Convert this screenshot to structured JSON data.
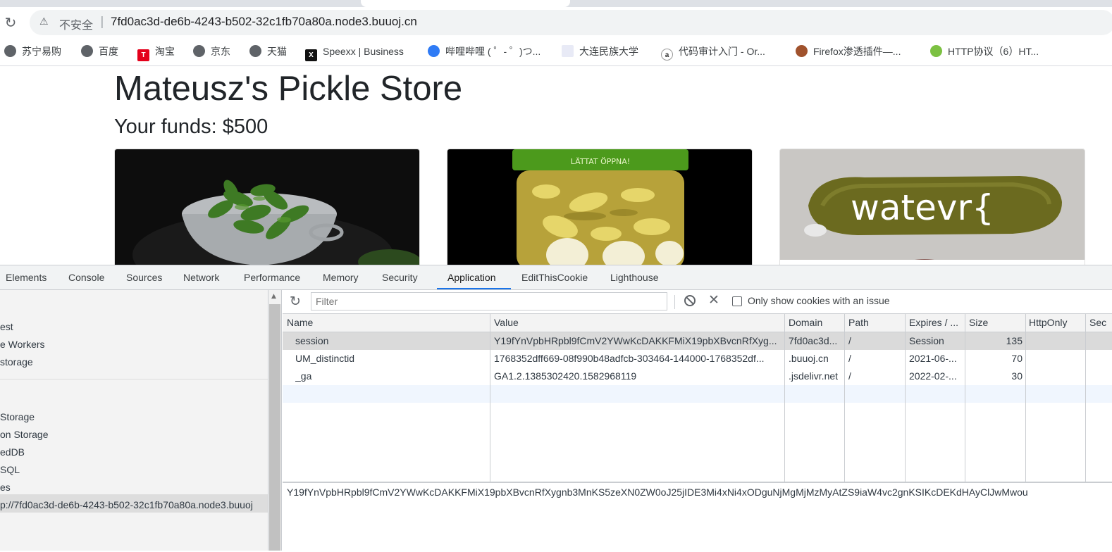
{
  "browser": {
    "omnibox": {
      "security_label": "不安全",
      "separator": "|",
      "url": "7fd0ac3d-de6b-4243-b502-32c1fb70a80a.node3.buuoj.cn"
    },
    "bookmarks": [
      {
        "label": "苏宁易购",
        "icon": "globe-icon"
      },
      {
        "label": "百度",
        "icon": "globe-icon"
      },
      {
        "label": "淘宝",
        "icon": "taobao-icon"
      },
      {
        "label": "京东",
        "icon": "globe-icon"
      },
      {
        "label": "天猫",
        "icon": "globe-icon"
      },
      {
        "label": "Speexx | Business",
        "icon": "speexx-icon"
      },
      {
        "label": "哔哩哔哩 ( ゜- ゜)つ...",
        "icon": "bilibili-icon"
      },
      {
        "label": "大连民族大学",
        "icon": "page-icon"
      },
      {
        "label": "代码审计入门 - Or...",
        "icon": "site-icon"
      },
      {
        "label": "Firefox渗透插件—...",
        "icon": "firefox-plugin-icon"
      },
      {
        "label": "HTTP协议（6）HT...",
        "icon": "leaf-icon"
      }
    ]
  },
  "page": {
    "title": "Mateusz's Pickle Store",
    "funds": "Your funds: $500",
    "card3_overlay_text": "watevr{",
    "jar_lid_text": "LÄTTAT ÖPPNA!"
  },
  "devtools": {
    "tabs": [
      "Elements",
      "Console",
      "Sources",
      "Network",
      "Performance",
      "Memory",
      "Security",
      "Application",
      "EditThisCookie",
      "Lighthouse"
    ],
    "active_tab": "Application",
    "sidebar": {
      "items": [
        "est",
        "e Workers",
        "storage",
        "Storage",
        "on Storage",
        "edDB",
        "SQL",
        "es",
        "p://7fd0ac3d-de6b-4243-b502-32c1fb70a80a.node3.buuoj"
      ]
    },
    "filter": {
      "placeholder": "Filter",
      "only_issues_label": "Only show cookies with an issue"
    },
    "cookies": {
      "columns": [
        "Name",
        "Value",
        "Domain",
        "Path",
        "Expires / ...",
        "Size",
        "HttpOnly",
        "Sec"
      ],
      "rows": [
        {
          "name": "session",
          "value": "Y19fYnVpbHRpbl9fCmV2YWwKcDAKKFMiX19pbXBvcnRfXyg...",
          "domain": "7fd0ac3d...",
          "path": "/",
          "expires": "Session",
          "size": "135"
        },
        {
          "name": "UM_distinctid",
          "value": "1768352dff669-08f990b48adfcb-303464-144000-1768352df...",
          "domain": ".buuoj.cn",
          "path": "/",
          "expires": "2021-06-...",
          "size": "70"
        },
        {
          "name": "_ga",
          "value": "GA1.2.1385302420.1582968119",
          "domain": ".jsdelivr.net",
          "path": "/",
          "expires": "2022-02-...",
          "size": "30"
        }
      ],
      "selected_value_full": "Y19fYnVpbHRpbl9fCmV2YWwKcDAKKFMiX19pbXBvcnRfXygnb3MnKS5zeXN0ZW0oJ25jIDE3Mi4xNi4xODguNjMgMjMzMyAtZS9iaW4vc2gnKSIKcDEKdHAyClJwMwou"
    }
  }
}
